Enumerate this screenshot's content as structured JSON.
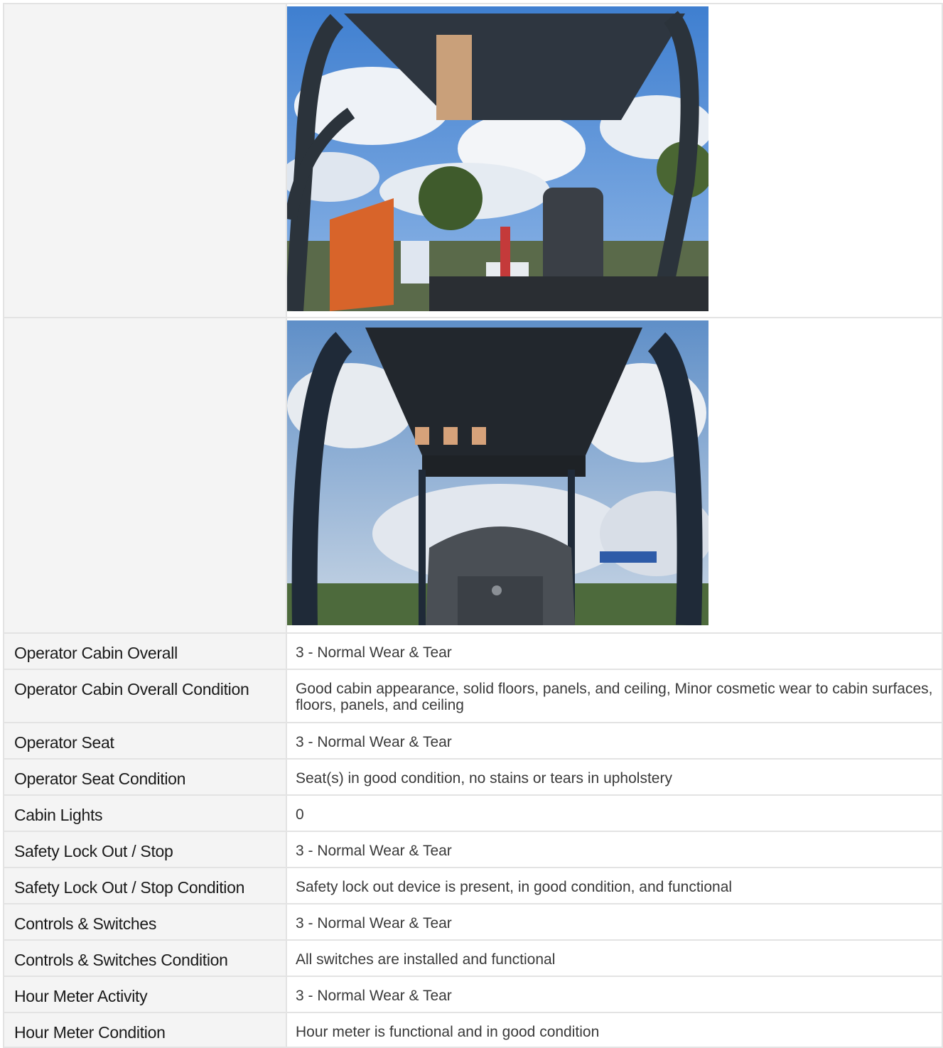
{
  "photos": [
    {
      "alt": "Operator canopy rear view"
    },
    {
      "alt": "Operator canopy front view"
    }
  ],
  "rows": [
    {
      "label": "Operator Cabin Overall",
      "value": "3 - Normal Wear & Tear"
    },
    {
      "label": "Operator Cabin Overall Condition",
      "value": "Good cabin appearance, solid floors, panels, and ceiling, Minor cosmetic wear to cabin surfaces, floors, panels, and ceiling"
    },
    {
      "label": "Operator Seat",
      "value": "3 - Normal Wear & Tear"
    },
    {
      "label": "Operator Seat Condition",
      "value": "Seat(s) in good condition, no stains or tears in upholstery"
    },
    {
      "label": "Cabin Lights",
      "value": "0"
    },
    {
      "label": "Safety Lock Out / Stop",
      "value": "3 - Normal Wear & Tear"
    },
    {
      "label": "Safety Lock Out / Stop Condition",
      "value": "Safety lock out device is present, in good condition, and functional"
    },
    {
      "label": "Controls & Switches",
      "value": "3 - Normal Wear & Tear"
    },
    {
      "label": "Controls & Switches Condition",
      "value": "All switches are installed and functional"
    },
    {
      "label": "Hour Meter Activity",
      "value": "3 - Normal Wear & Tear"
    },
    {
      "label": "Hour Meter Condition",
      "value": "Hour meter is functional and in good condition"
    }
  ]
}
